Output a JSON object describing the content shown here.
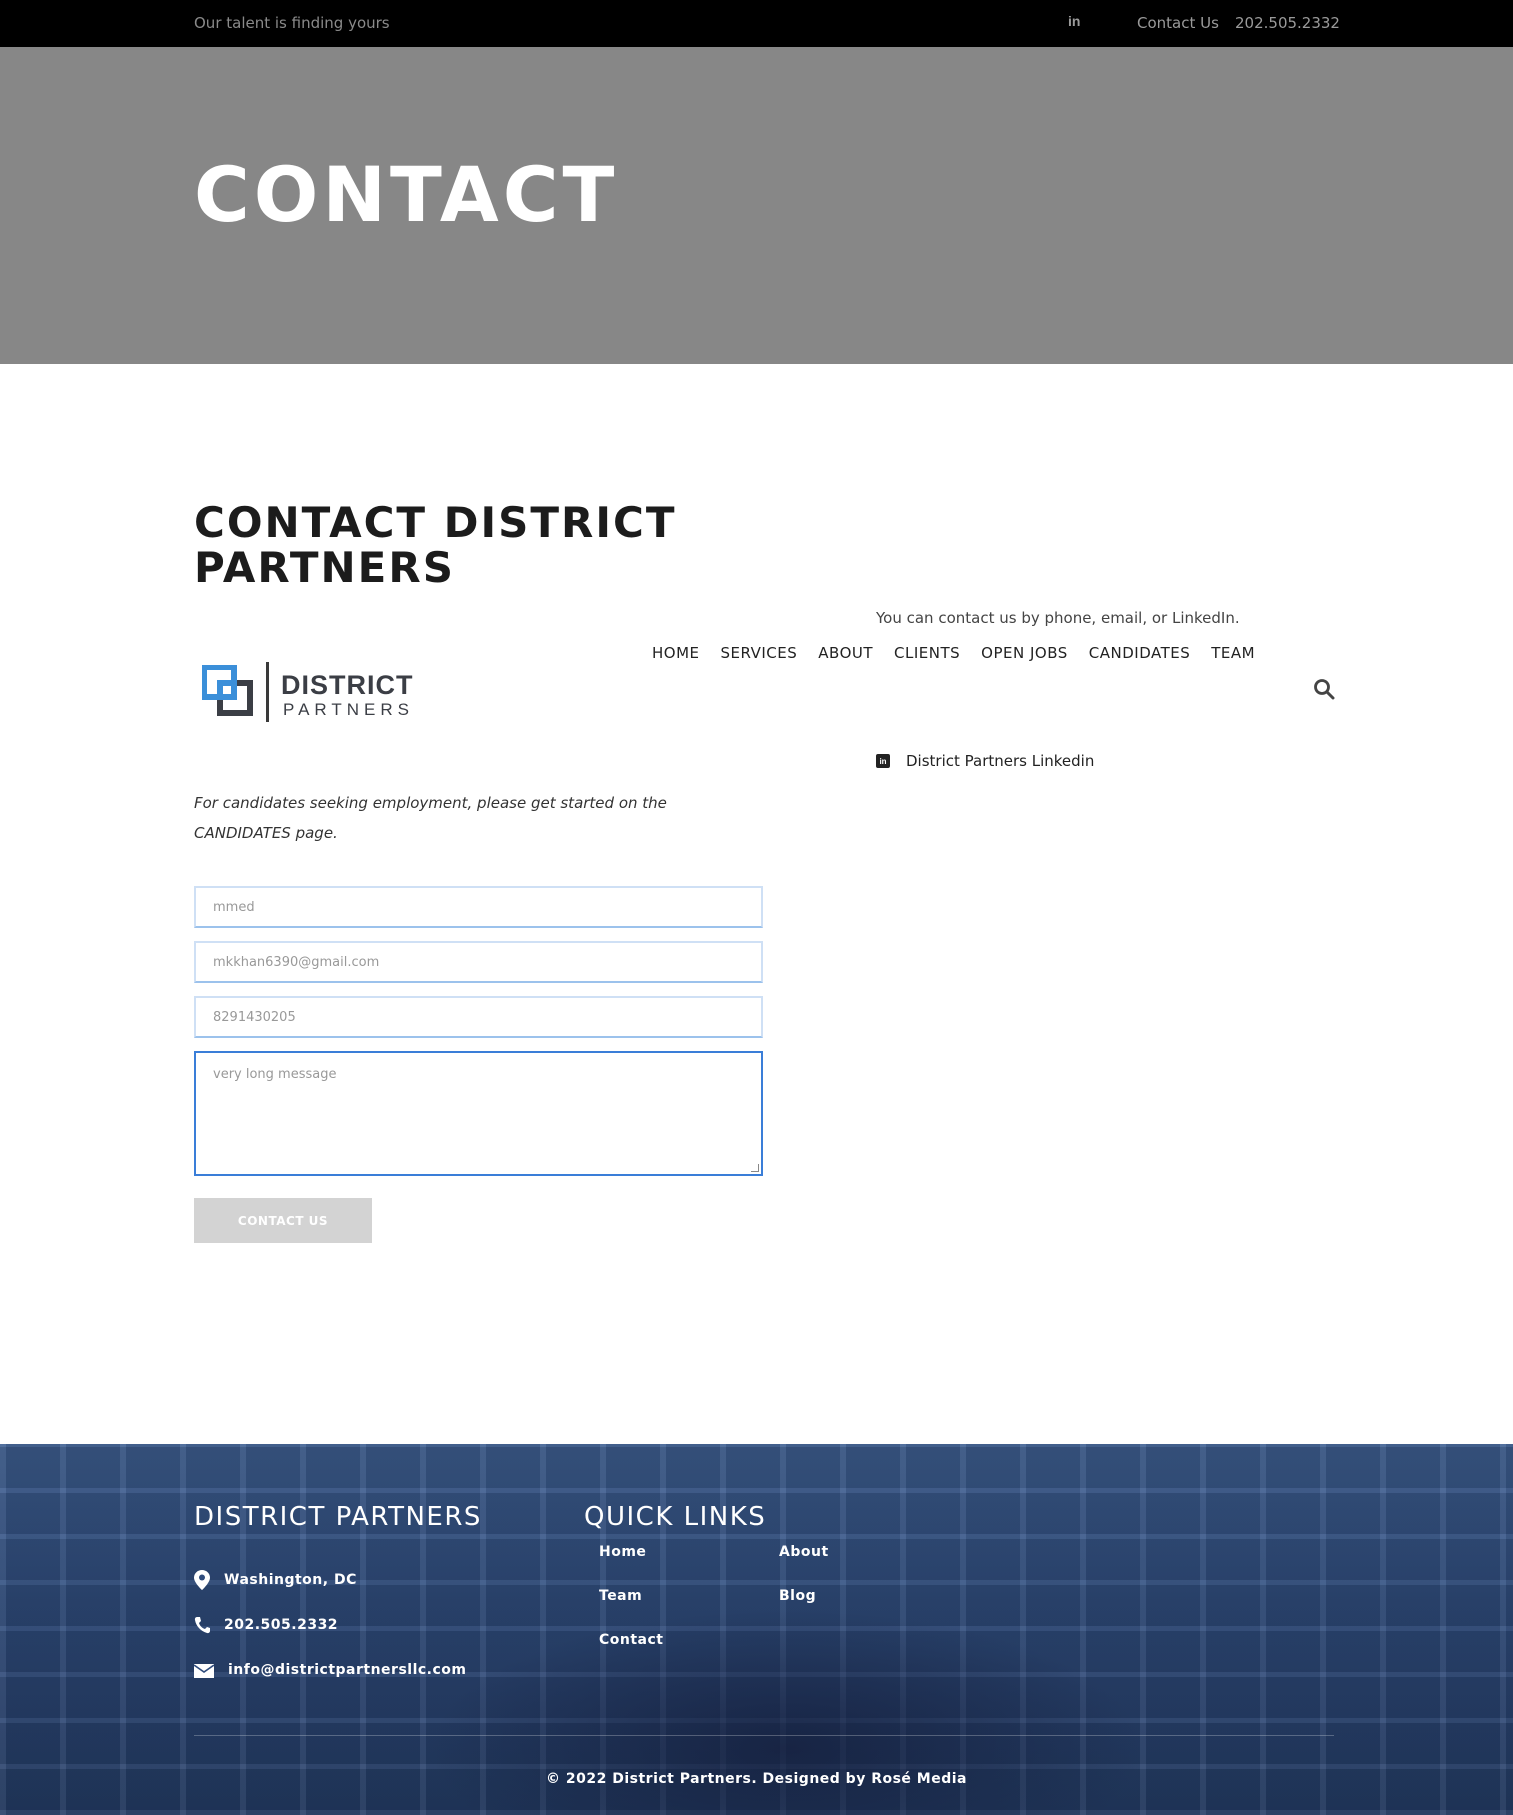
{
  "topbar": {
    "tagline": "Our talent is finding yours",
    "linkedin_label": "in",
    "contact_label": "Contact Us",
    "phone": "202.505.2332"
  },
  "hero": {
    "title": "CONTACT"
  },
  "main": {
    "title": "CONTACT DISTRICT PARTNERS",
    "intro": "You can contact us by phone, email, or LinkedIn.",
    "linkedin_link": "District Partners Linkedin",
    "candidates_note": "For candidates seeking employment, please get started on the CANDIDATES page."
  },
  "nav": {
    "items": [
      "HOME",
      "SERVICES",
      "ABOUT",
      "CLIENTS",
      "OPEN JOBS",
      "CANDIDATES",
      "TEAM"
    ]
  },
  "logo": {
    "line1": "DISTRICT",
    "line2": "PARTNERS"
  },
  "form": {
    "name_value": "mmed",
    "email_value": "mkkhan6390@gmail.com",
    "phone_value": "8291430205",
    "message_value": "very long message",
    "submit_label": "CONTACT US"
  },
  "footer": {
    "company_title": "DISTRICT PARTNERS",
    "location": "Washington, DC",
    "phone": "202.505.2332",
    "email": "info@districtpartnersllc.com",
    "quick_links_title": "QUICK LINKS",
    "links": [
      "Home",
      "About",
      "Team",
      "Blog",
      "Contact"
    ],
    "copyright": "© 2022 District Partners. Designed by Rosé Media"
  },
  "colors": {
    "topbar_bg": "#000000",
    "hero_bg": "#878787",
    "footer_bg": "#2f4c7d",
    "logo_blue": "#3b8fd9",
    "logo_dark": "#3b3e45",
    "submit_bg": "#d3d3d3"
  }
}
